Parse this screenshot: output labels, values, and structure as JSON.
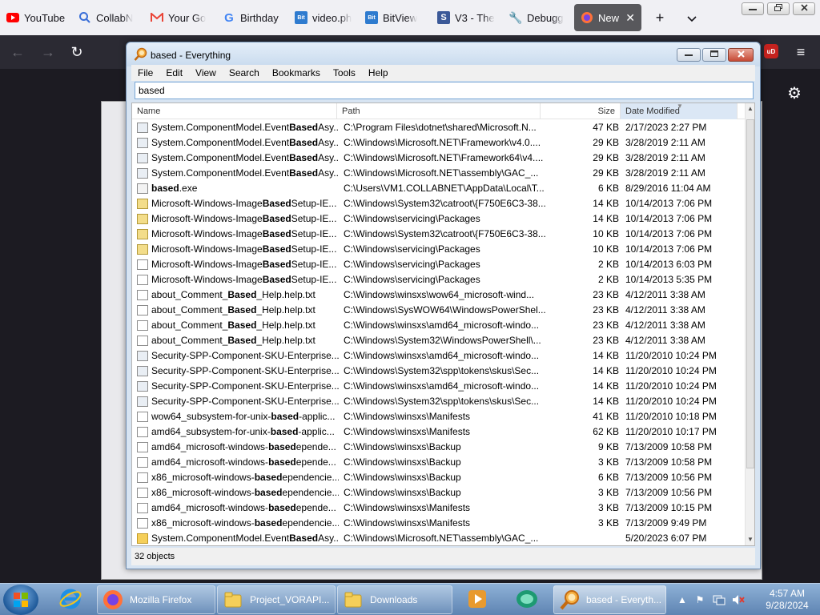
{
  "browser": {
    "tabs": [
      {
        "label": "YouTube",
        "icon": "youtube-icon"
      },
      {
        "label": "CollabN",
        "icon": "search-icon"
      },
      {
        "label": "Your Go",
        "icon": "gmail-icon"
      },
      {
        "label": "Birthday",
        "icon": "google-icon"
      },
      {
        "label": "video.ph",
        "icon": "bitview-icon"
      },
      {
        "label": "BitView",
        "icon": "bitview-icon"
      },
      {
        "label": "V3 - The",
        "icon": "wiki-icon"
      },
      {
        "label": "Debugg",
        "icon": "wrench-icon"
      },
      {
        "label": "New T",
        "icon": "firefox-icon",
        "active": true
      }
    ],
    "new_tab_symbol": "+",
    "tab_list_symbol": "⌄",
    "close_tab_symbol": "✕",
    "nav": {
      "back": "←",
      "forward": "→",
      "reload": "↻",
      "menu": "≡",
      "settings": "⚙"
    },
    "ublock_label": "uD"
  },
  "everything": {
    "title": "based - Everything",
    "menu": [
      "File",
      "Edit",
      "View",
      "Search",
      "Bookmarks",
      "Tools",
      "Help"
    ],
    "search_value": "based",
    "columns": {
      "name": "Name",
      "path": "Path",
      "size": "Size",
      "date": "Date Modified"
    },
    "rows": [
      {
        "icon": "cfg",
        "pre": "System.ComponentModel.Event",
        "match": "Based",
        "post": "Asy...",
        "path": "C:\\Program Files\\dotnet\\shared\\Microsoft.N...",
        "size": "47 KB",
        "date": "2/17/2023 2:27 PM"
      },
      {
        "icon": "cfg",
        "pre": "System.ComponentModel.Event",
        "match": "Based",
        "post": "Asy...",
        "path": "C:\\Windows\\Microsoft.NET\\Framework\\v4.0....",
        "size": "29 KB",
        "date": "3/28/2019 2:11 AM"
      },
      {
        "icon": "cfg",
        "pre": "System.ComponentModel.Event",
        "match": "Based",
        "post": "Asy...",
        "path": "C:\\Windows\\Microsoft.NET\\Framework64\\v4....",
        "size": "29 KB",
        "date": "3/28/2019 2:11 AM"
      },
      {
        "icon": "cfg",
        "pre": "System.ComponentModel.Event",
        "match": "Based",
        "post": "Asy...",
        "path": "C:\\Windows\\Microsoft.NET\\assembly\\GAC_...",
        "size": "29 KB",
        "date": "3/28/2019 2:11 AM"
      },
      {
        "icon": "exe",
        "pre": "",
        "match": "based",
        "post": ".exe",
        "path": "C:\\Users\\VM1.COLLABNET\\AppData\\Local\\T...",
        "size": "6 KB",
        "date": "8/29/2016 11:04 AM"
      },
      {
        "icon": "pkg",
        "pre": "Microsoft-Windows-Image",
        "match": "Based",
        "post": "Setup-IE...",
        "path": "C:\\Windows\\System32\\catroot\\{F750E6C3-38...",
        "size": "14 KB",
        "date": "10/14/2013 7:06 PM"
      },
      {
        "icon": "pkg",
        "pre": "Microsoft-Windows-Image",
        "match": "Based",
        "post": "Setup-IE...",
        "path": "C:\\Windows\\servicing\\Packages",
        "size": "14 KB",
        "date": "10/14/2013 7:06 PM"
      },
      {
        "icon": "pkg",
        "pre": "Microsoft-Windows-Image",
        "match": "Based",
        "post": "Setup-IE...",
        "path": "C:\\Windows\\System32\\catroot\\{F750E6C3-38...",
        "size": "10 KB",
        "date": "10/14/2013 7:06 PM"
      },
      {
        "icon": "pkg",
        "pre": "Microsoft-Windows-Image",
        "match": "Based",
        "post": "Setup-IE...",
        "path": "C:\\Windows\\servicing\\Packages",
        "size": "10 KB",
        "date": "10/14/2013 7:06 PM"
      },
      {
        "icon": "doc",
        "pre": "Microsoft-Windows-Image",
        "match": "Based",
        "post": "Setup-IE...",
        "path": "C:\\Windows\\servicing\\Packages",
        "size": "2 KB",
        "date": "10/14/2013 6:03 PM"
      },
      {
        "icon": "doc",
        "pre": "Microsoft-Windows-Image",
        "match": "Based",
        "post": "Setup-IE...",
        "path": "C:\\Windows\\servicing\\Packages",
        "size": "2 KB",
        "date": "10/14/2013 5:35 PM"
      },
      {
        "icon": "doc",
        "pre": "about_Comment_",
        "match": "Based",
        "post": "_Help.help.txt",
        "path": "C:\\Windows\\winsxs\\wow64_microsoft-wind...",
        "size": "23 KB",
        "date": "4/12/2011 3:38 AM"
      },
      {
        "icon": "doc",
        "pre": "about_Comment_",
        "match": "Based",
        "post": "_Help.help.txt",
        "path": "C:\\Windows\\SysWOW64\\WindowsPowerShel...",
        "size": "23 KB",
        "date": "4/12/2011 3:38 AM"
      },
      {
        "icon": "doc",
        "pre": "about_Comment_",
        "match": "Based",
        "post": "_Help.help.txt",
        "path": "C:\\Windows\\winsxs\\amd64_microsoft-windo...",
        "size": "23 KB",
        "date": "4/12/2011 3:38 AM"
      },
      {
        "icon": "doc",
        "pre": "about_Comment_",
        "match": "Based",
        "post": "_Help.help.txt",
        "path": "C:\\Windows\\System32\\WindowsPowerShell\\...",
        "size": "23 KB",
        "date": "4/12/2011 3:38 AM"
      },
      {
        "icon": "cfg",
        "pre": "Security-SPP-Component-SKU-Enterprise...",
        "match": "",
        "post": "",
        "path": "C:\\Windows\\winsxs\\amd64_microsoft-windo...",
        "size": "14 KB",
        "date": "11/20/2010 10:24 PM"
      },
      {
        "icon": "cfg",
        "pre": "Security-SPP-Component-SKU-Enterprise...",
        "match": "",
        "post": "",
        "path": "C:\\Windows\\System32\\spp\\tokens\\skus\\Sec...",
        "size": "14 KB",
        "date": "11/20/2010 10:24 PM"
      },
      {
        "icon": "cfg",
        "pre": "Security-SPP-Component-SKU-Enterprise...",
        "match": "",
        "post": "",
        "path": "C:\\Windows\\winsxs\\amd64_microsoft-windo...",
        "size": "14 KB",
        "date": "11/20/2010 10:24 PM"
      },
      {
        "icon": "cfg",
        "pre": "Security-SPP-Component-SKU-Enterprise...",
        "match": "",
        "post": "",
        "path": "C:\\Windows\\System32\\spp\\tokens\\skus\\Sec...",
        "size": "14 KB",
        "date": "11/20/2010 10:24 PM"
      },
      {
        "icon": "doc",
        "pre": "wow64_subsystem-for-unix-",
        "match": "based",
        "post": "-applic...",
        "path": "C:\\Windows\\winsxs\\Manifests",
        "size": "41 KB",
        "date": "11/20/2010 10:18 PM"
      },
      {
        "icon": "doc",
        "pre": "amd64_subsystem-for-unix-",
        "match": "based",
        "post": "-applic...",
        "path": "C:\\Windows\\winsxs\\Manifests",
        "size": "62 KB",
        "date": "11/20/2010 10:17 PM"
      },
      {
        "icon": "doc",
        "pre": "amd64_microsoft-windows-",
        "match": "based",
        "post": "epende...",
        "path": "C:\\Windows\\winsxs\\Backup",
        "size": "9 KB",
        "date": "7/13/2009 10:58 PM"
      },
      {
        "icon": "doc",
        "pre": "amd64_microsoft-windows-",
        "match": "based",
        "post": "epende...",
        "path": "C:\\Windows\\winsxs\\Backup",
        "size": "3 KB",
        "date": "7/13/2009 10:58 PM"
      },
      {
        "icon": "doc",
        "pre": "x86_microsoft-windows-",
        "match": "based",
        "post": "ependencie...",
        "path": "C:\\Windows\\winsxs\\Backup",
        "size": "6 KB",
        "date": "7/13/2009 10:56 PM"
      },
      {
        "icon": "doc",
        "pre": "x86_microsoft-windows-",
        "match": "based",
        "post": "ependencie...",
        "path": "C:\\Windows\\winsxs\\Backup",
        "size": "3 KB",
        "date": "7/13/2009 10:56 PM"
      },
      {
        "icon": "doc",
        "pre": "amd64_microsoft-windows-",
        "match": "based",
        "post": "epende...",
        "path": "C:\\Windows\\winsxs\\Manifests",
        "size": "3 KB",
        "date": "7/13/2009 10:15 PM"
      },
      {
        "icon": "doc",
        "pre": "x86_microsoft-windows-",
        "match": "based",
        "post": "ependencie...",
        "path": "C:\\Windows\\winsxs\\Manifests",
        "size": "3 KB",
        "date": "7/13/2009 9:49 PM"
      },
      {
        "icon": "fold",
        "pre": "System.ComponentModel.Event",
        "match": "Based",
        "post": "Asy...",
        "path": "C:\\Windows\\Microsoft.NET\\assembly\\GAC_...",
        "size": "",
        "date": "5/20/2023 6:07 PM"
      }
    ],
    "status": "32 objects"
  },
  "taskbar": {
    "items": [
      {
        "label": "Mozilla Firefox",
        "icon": "firefox-icon"
      },
      {
        "label": "Project_VORAPI...",
        "icon": "folder-icon"
      },
      {
        "label": "Downloads",
        "icon": "folder-icon"
      },
      {
        "label": "based - Everyth...",
        "icon": "everything-search-icon",
        "active": true
      }
    ],
    "clock_time": "4:57 AM",
    "clock_date": "9/28/2024"
  },
  "colors": {
    "match_text": "#000000",
    "active_tab": "#58585c",
    "browser_dark": "#2b2a33",
    "taskbar": "#5e84b2"
  }
}
